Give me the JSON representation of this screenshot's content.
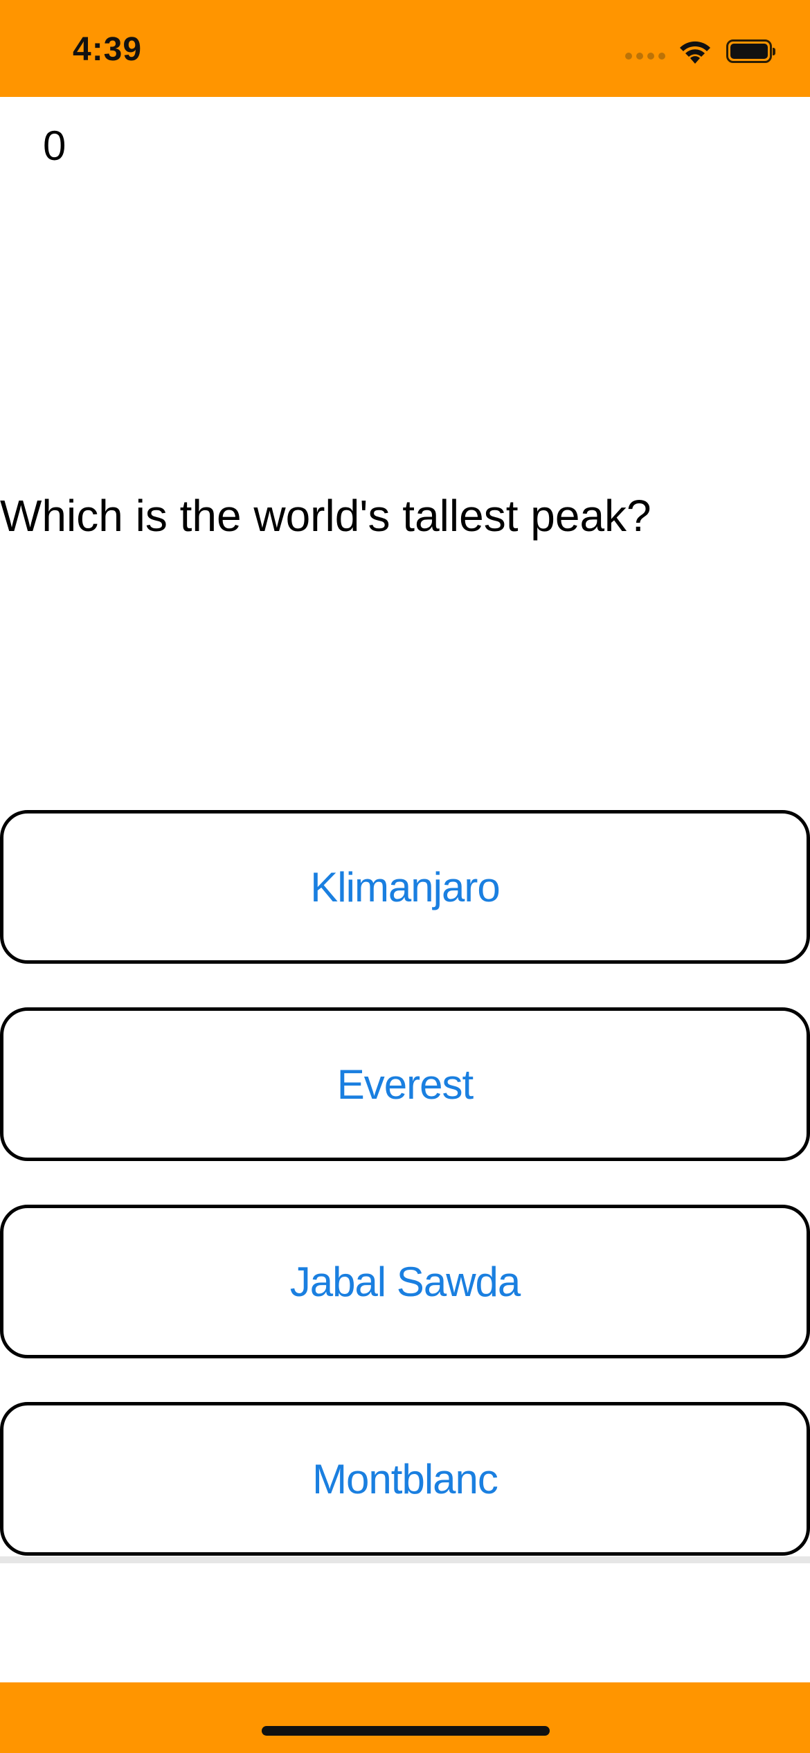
{
  "status_bar": {
    "time": "4:39",
    "background_color": "#FF9500",
    "icons": [
      "signal-dots-icon",
      "wifi-icon",
      "battery-icon"
    ]
  },
  "quiz": {
    "score": "0",
    "question": "Which is the world's tallest peak?",
    "answers": [
      {
        "label": "Klimanjaro"
      },
      {
        "label": "Everest"
      },
      {
        "label": "Jabal Sawda"
      },
      {
        "label": "Montblanc"
      }
    ],
    "answer_text_color": "#1a7fe0",
    "answer_border_color": "#000000"
  },
  "bottom_bar": {
    "background_color": "#FF9500"
  }
}
